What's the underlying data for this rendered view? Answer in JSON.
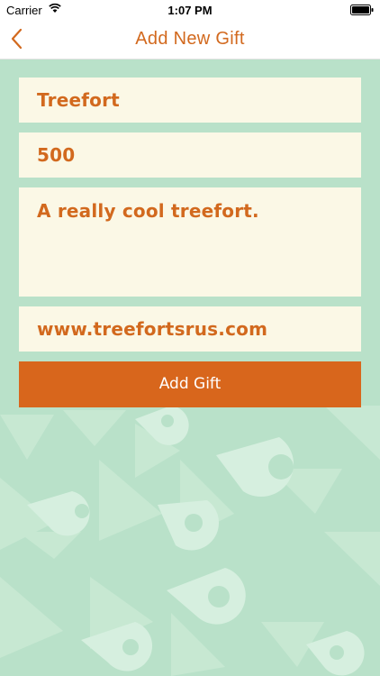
{
  "status_bar": {
    "carrier": "Carrier",
    "time": "1:07 PM",
    "wifi_icon": "wifi-icon",
    "battery_icon": "battery-icon"
  },
  "nav": {
    "title": "Add New Gift",
    "back_icon": "chevron-left-icon"
  },
  "form": {
    "name_value": "Treefort",
    "price_value": "500",
    "description_value": "A really cool treefort.",
    "url_value": "www.treefortsrus.com",
    "submit_label": "Add Gift"
  },
  "colors": {
    "accent": "#d8661c",
    "text_accent": "#d2691e",
    "field_bg": "#fbf8e6",
    "page_bg": "#b9e1c9"
  }
}
